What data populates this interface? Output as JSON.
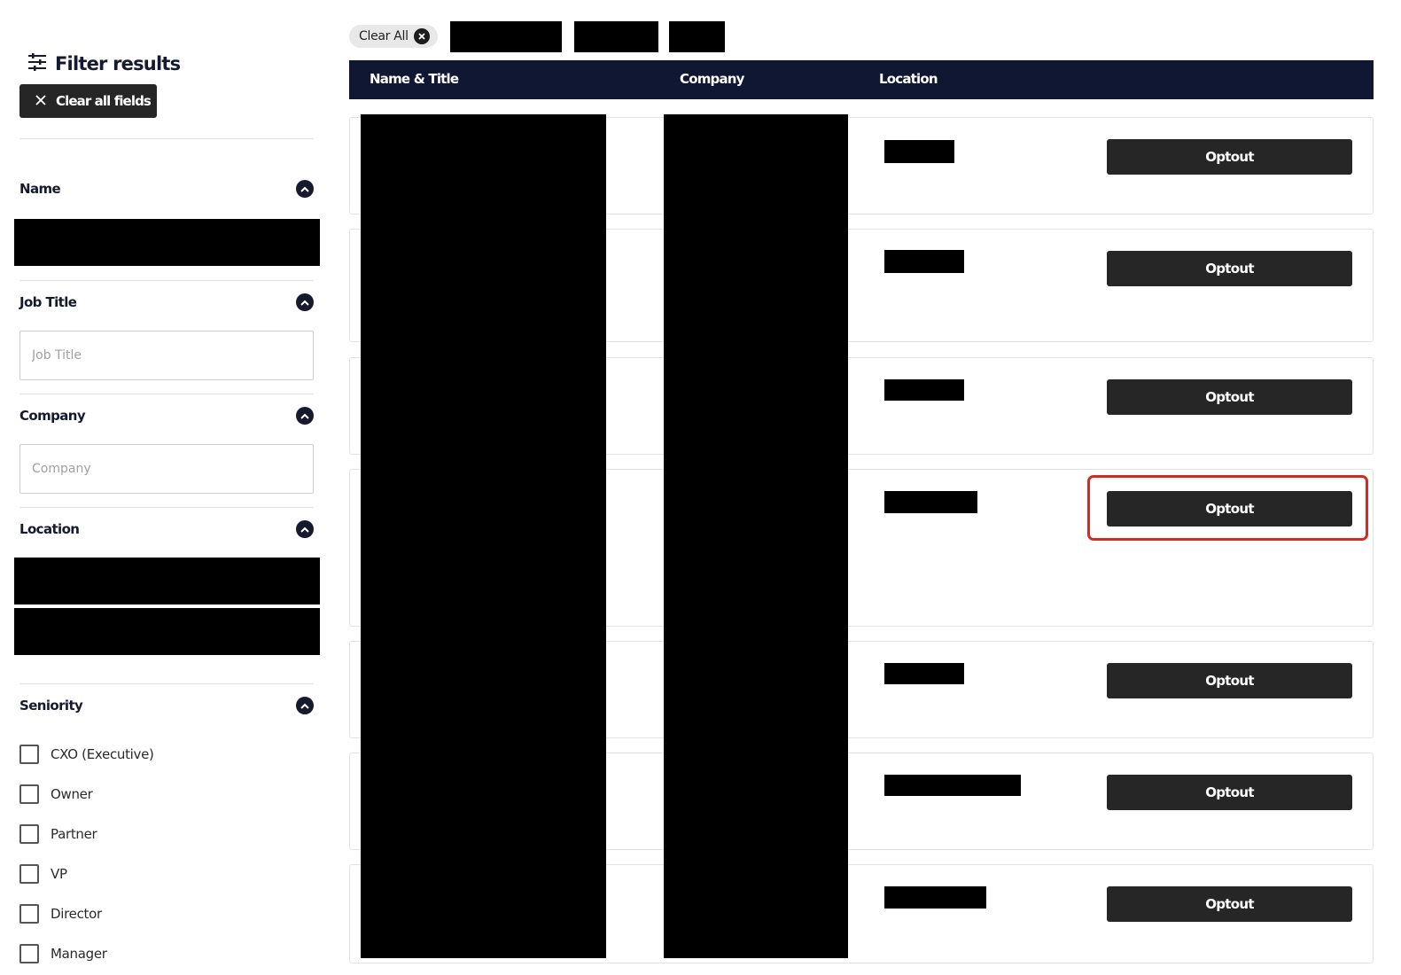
{
  "sidebar": {
    "title": "Filter results",
    "clear_all_fields_label": "Clear all fields",
    "sections": {
      "name": {
        "label": "Name"
      },
      "job_title": {
        "label": "Job Title",
        "placeholder": "Job Title",
        "value": ""
      },
      "company": {
        "label": "Company",
        "placeholder": "Company",
        "value": ""
      },
      "location": {
        "label": "Location"
      },
      "seniority": {
        "label": "Seniority",
        "options": [
          "CXO (Executive)",
          "Owner",
          "Partner",
          "VP",
          "Director",
          "Manager"
        ]
      }
    }
  },
  "main": {
    "clear_all_chip": "Clear All",
    "columns": [
      "Name & Title",
      "Company",
      "Location"
    ],
    "row_action_label": "Optout",
    "row_count": 7
  },
  "colors": {
    "header_bg": "#0f1733",
    "button_bg": "#262626",
    "highlight_border": "#d42a24"
  },
  "icons": {
    "filter": "sliders-icon",
    "clear_fields": "close-icon",
    "section_toggle": "chevron-up-icon",
    "chip_remove": "close-circle-icon"
  }
}
